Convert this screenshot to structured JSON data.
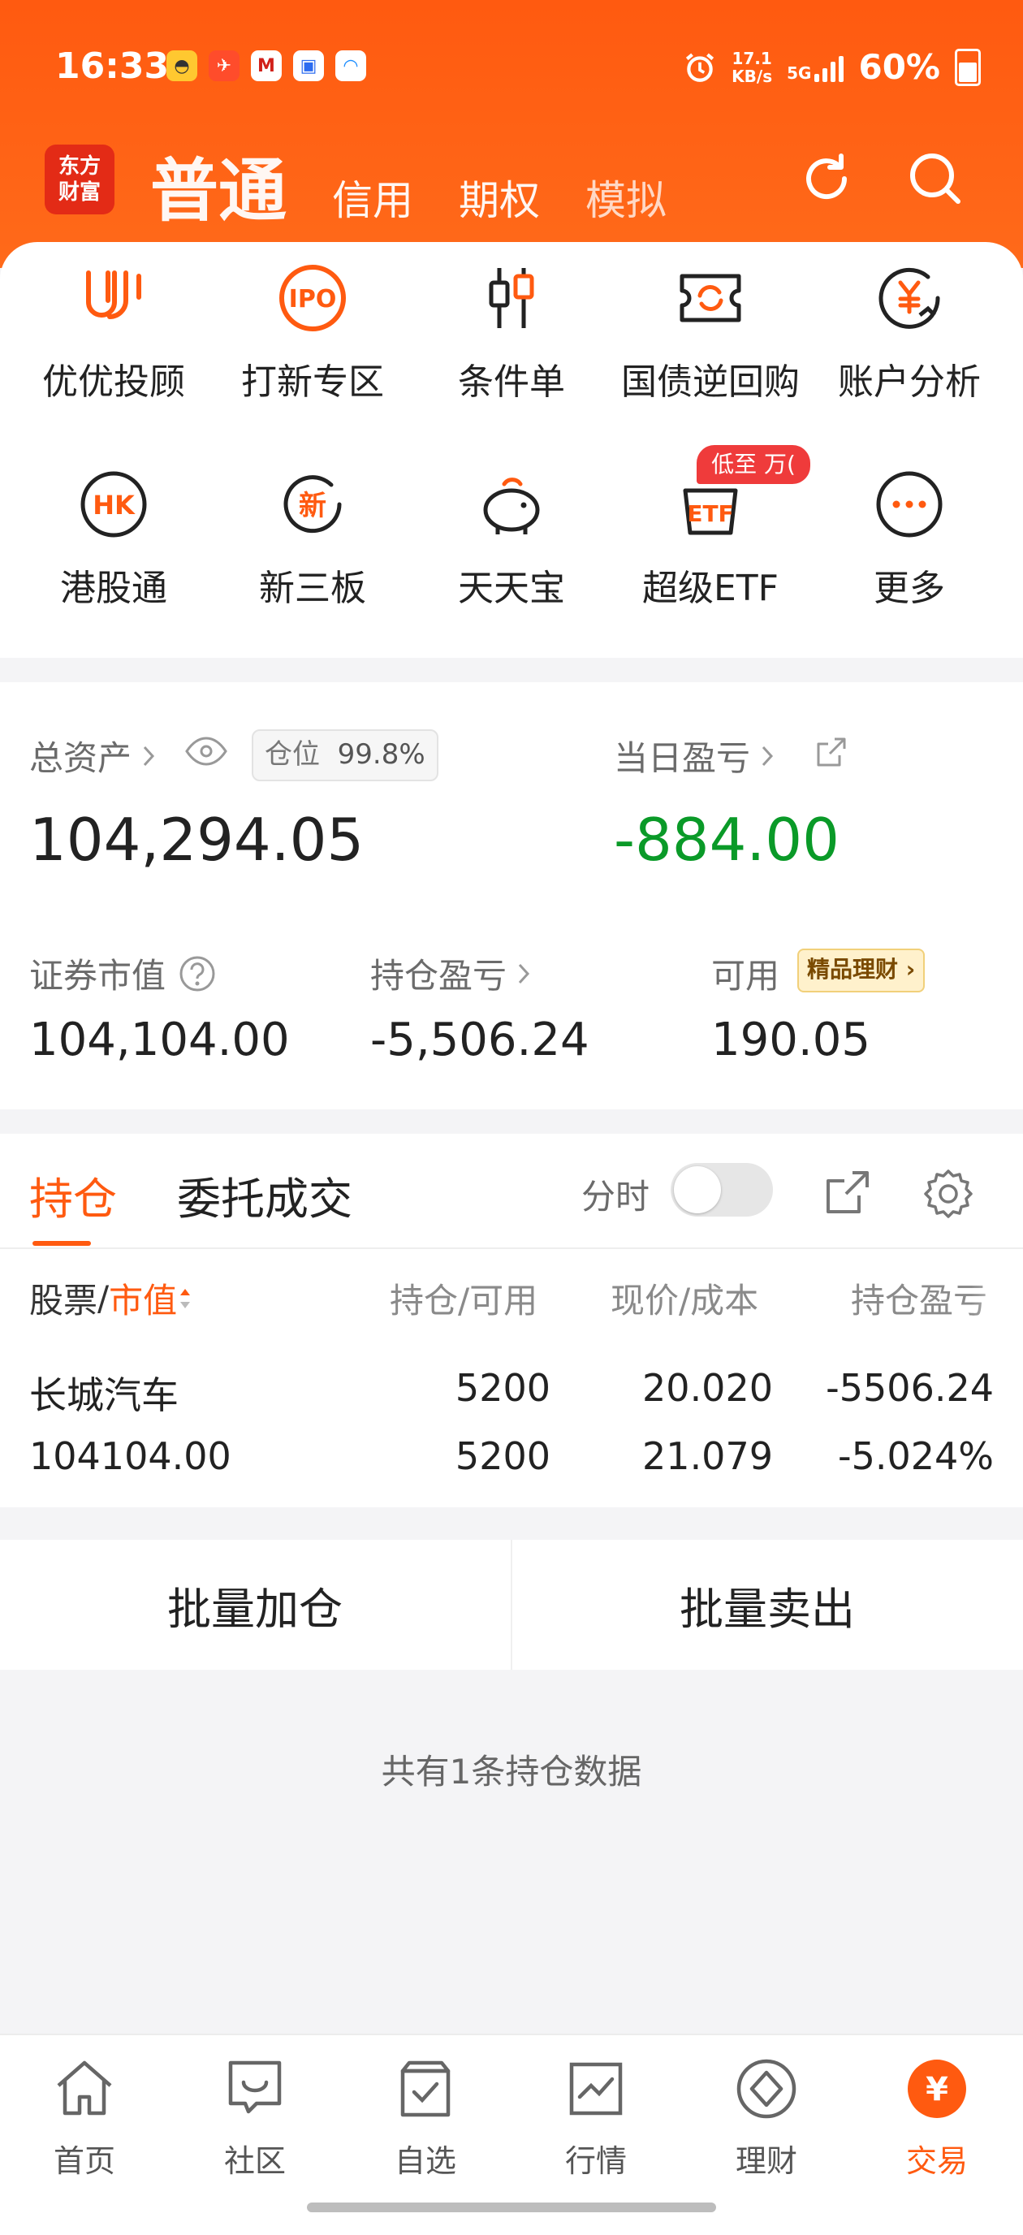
{
  "status_bar": {
    "time": "16:33",
    "speed_value": "17.1",
    "speed_unit": "KB/s",
    "network": "5G",
    "battery": "60%"
  },
  "header": {
    "logo_line1": "东方",
    "logo_line2": "财富",
    "tabs": [
      "普通",
      "信用",
      "期权",
      "模拟"
    ]
  },
  "grid": {
    "items": [
      "优优投顾",
      "打新专区",
      "条件单",
      "国债逆回购",
      "账户分析",
      "港股通",
      "新三板",
      "天天宝",
      "超级ETF",
      "更多"
    ],
    "ipo_icon_text": "IPO",
    "hk_icon_text": "HK",
    "new_icon_text": "新",
    "etf_icon_text": "ETF",
    "etf_badge": "低至 万(",
    "more_dots": "···"
  },
  "assets": {
    "total_label": "总资产",
    "position_label": "仓位",
    "position_value": "99.8%",
    "total_value": "104,294.05",
    "daily_pl_label": "当日盈亏",
    "daily_pl_value": "-884.00",
    "market_value_label": "证券市值",
    "market_value": "104,104.00",
    "hold_pl_label": "持仓盈亏",
    "hold_pl_value": "-5,506.24",
    "available_label": "可用",
    "available_chip": "精品理财",
    "available_value": "190.05"
  },
  "positions": {
    "tab_hold": "持仓",
    "tab_orders": "委托成交",
    "timeshare_label": "分时",
    "col_stock": "股票",
    "col_value": "市值",
    "col_hold": "持仓/可用",
    "col_price": "现价/成本",
    "col_pl": "持仓盈亏",
    "rows": [
      {
        "name": "长城汽车",
        "market_value": "104104.00",
        "hold": "5200",
        "available": "5200",
        "price": "20.020",
        "cost": "21.079",
        "pl": "-5506.24",
        "pl_pct": "-5.024%"
      }
    ]
  },
  "actions": {
    "batch_add": "批量加仓",
    "batch_sell": "批量卖出"
  },
  "footnote": "共有1条持仓数据",
  "nav": {
    "items": [
      "首页",
      "社区",
      "自选",
      "行情",
      "理财",
      "交易"
    ],
    "trade_icon_text": "¥"
  },
  "colors": {
    "brand": "#ff5a10",
    "loss_green": "#0a9a28"
  }
}
